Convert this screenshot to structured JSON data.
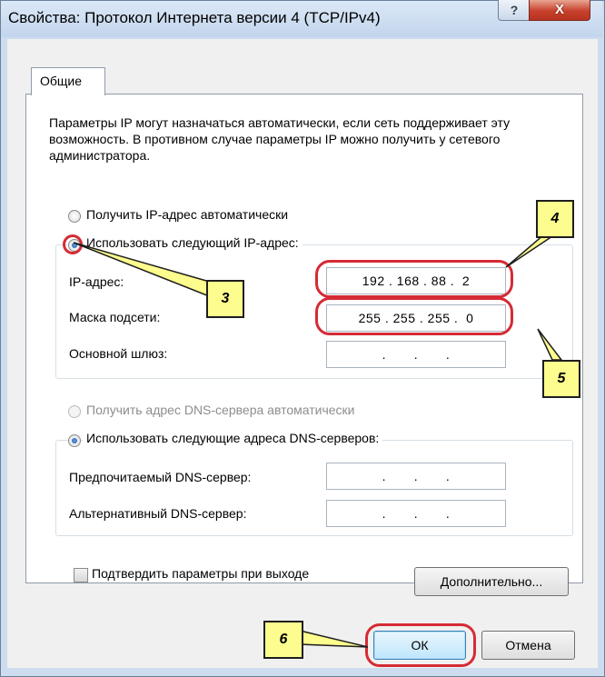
{
  "window": {
    "title": "Свойства: Протокол Интернета версии 4 (TCP/IPv4)",
    "help_glyph": "?",
    "close_glyph": "X"
  },
  "tabs": [
    {
      "label": "Общие"
    }
  ],
  "description": "Параметры IP могут назначаться автоматически, если сеть поддерживает эту возможность. В противном случае параметры IP можно получить у сетевого администратора.",
  "ip_section": {
    "auto_label": "Получить IP-адрес автоматически",
    "manual_label": "Использовать следующий IP-адрес:",
    "selected": "manual",
    "fields": [
      {
        "label": "IP-адрес:",
        "value": "192 . 168 . 88 .  2"
      },
      {
        "label": "Маска подсети:",
        "value": "255 . 255 . 255 .  0"
      },
      {
        "label": "Основной шлюз:",
        "value": " .       .       . "
      }
    ]
  },
  "dns_section": {
    "auto_label": "Получить адрес DNS-сервера автоматически",
    "auto_disabled": true,
    "manual_label": "Использовать следующие адреса DNS-серверов:",
    "selected": "manual",
    "fields": [
      {
        "label": "Предпочитаемый DNS-сервер:",
        "value": " .       .       . "
      },
      {
        "label": "Альтернативный DNS-сервер:",
        "value": " .       .       . "
      }
    ]
  },
  "validate_on_exit": {
    "label": "Подтвердить параметры при выходе",
    "checked": false
  },
  "buttons": {
    "advanced": "Дополнительно...",
    "ok": "ОК",
    "cancel": "Отмена"
  },
  "callouts": {
    "c3": "3",
    "c4": "4",
    "c5": "5",
    "c6": "6"
  },
  "colors": {
    "highlight_ring": "#d52b35",
    "callout_fill": "#fdfc8e",
    "close_button": "#c7412c"
  }
}
